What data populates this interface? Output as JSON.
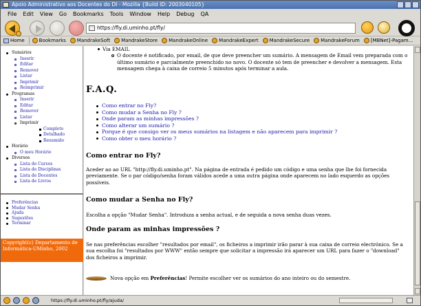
{
  "window": {
    "title": "Apoio Administrativo aos Docentes do DI - Mozilla {Build ID: 2003040105}"
  },
  "menu": [
    "File",
    "Edit",
    "View",
    "Go",
    "Bookmarks",
    "Tools",
    "Window",
    "Help",
    "Debug",
    "QA"
  ],
  "address": {
    "url": "https://fly.di.uminho.pt/fly/"
  },
  "bookmarks": [
    "Home",
    "Bookmarks",
    "MandrakeSoft",
    "MandrakeStore",
    "MandrakeOnline",
    "MandrakeExpert",
    "MandrakeSecure",
    "MandrakeForum",
    "[MBNet]-Pagam..."
  ],
  "sidebar": {
    "sumarios": {
      "label": "Sumários",
      "items": [
        "Inserir",
        "Editar",
        "Remover",
        "Listar",
        "Imprimir",
        "Reimprimir"
      ]
    },
    "programas": {
      "label": "Programas",
      "items": [
        "Inserir",
        "Editar",
        "Remover",
        "Listar"
      ],
      "imprimir": "Imprimir",
      "sub": [
        "Completo",
        "Detalhado",
        "Resumido"
      ]
    },
    "horario": {
      "label": "Horário",
      "items": [
        "O meu Horário"
      ]
    },
    "diversos": {
      "label": "Diversos",
      "items": [
        "Lista de Cursos",
        "Lista de Disciplinas",
        "Lista de Docentes",
        "Lista de Livros"
      ]
    },
    "bottom": [
      "Preferências",
      "Mudar Senha",
      "Ajuda",
      "Sugestões",
      "Terminar"
    ],
    "copyright": "Copyright(c) Departamento de Informática-UMinho, 2002"
  },
  "content": {
    "via_email": "Via EMAIL",
    "email_text": "O docente é notificado, por email, de que deve preencher um sumário. A mensagem de Email vem preparada com o último sumário e parcialmente preenchido no novo. O docente só tem de preencher e devolver a mensagem. Esta mensagem chega à caixa de correio 5 minutos após terminar a aula.",
    "faq_title": "F.A.Q.",
    "faq_links": [
      "Como entrar no Fly?",
      "Como mudar a Senha no Fly ?",
      "Onde param as minhas impressões ?",
      "Como alterar um sumário ?",
      "Porque é que consigo ver os meus sumários na listagem e não aparecem para imprimir ?",
      "Como obter o meu horário ?"
    ],
    "q1_title": "Como entrar no Fly?",
    "q1_text": "Aceder ao ao URL \"http://fly.di.uminho.pt\". Na página de entrada é pedido um código e uma senha que lhe foi fornecida previamente. Se o par código/senha foram válidos acede a uma outra página onde aparecem no lado esquerdo as opções possíveis.",
    "q2_title": "Como mudar a Senha no Fly?",
    "q2_text": "Escolha a opção \"Mudar Senha\". Introduza a senha actual, e de seguida a nova senha duas vezes.",
    "q3_title": "Onde param as minhas impressões ?",
    "q3_text": "Se nas preferências escolher \"resultados por email\", os ficheiros a imprimir irão parar à sua caixa de correio electrónico. Se a sua escolha foi \"resultados por WWW\" então sempre que solicitar a impressão irá aparecer um URL para fazer o \"download\" dos ficheiros a imprimir.",
    "news_prefix": "Nova opção em",
    "news_bold": "Preferências",
    "news_suffix": "! Permite escolher ver os sumários do ano inteiro ou do semestre."
  },
  "status": {
    "text": "https://fly.di.uminho.pt/fly/ajuda/"
  }
}
